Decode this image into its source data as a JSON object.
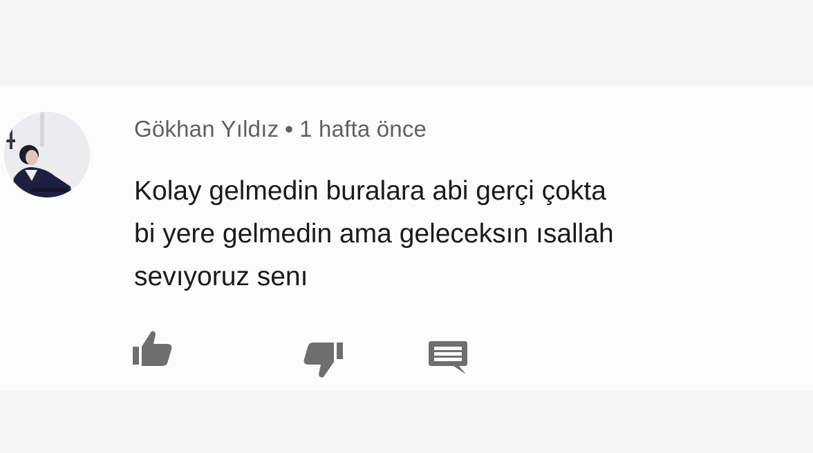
{
  "comment": {
    "author": "Gökhan Yıldız",
    "separator": "•",
    "timestamp": "1 hafta önce",
    "text_lines": [
      "Kolay gelmedin buralara abi gerçi çokta",
      "bi yere gelmedin ama geleceksın ısallah",
      "sevıyoruz senı"
    ]
  },
  "actions": {
    "like_icon": "thumbs-up-icon",
    "dislike_icon": "thumbs-down-icon",
    "reply_icon": "comment-icon"
  },
  "colors": {
    "background": "#f3f6f4",
    "card": "#fbfdfc",
    "author_text": "#5f6061",
    "body_text": "#1a1a1b",
    "icon": "#6e6e6e"
  }
}
